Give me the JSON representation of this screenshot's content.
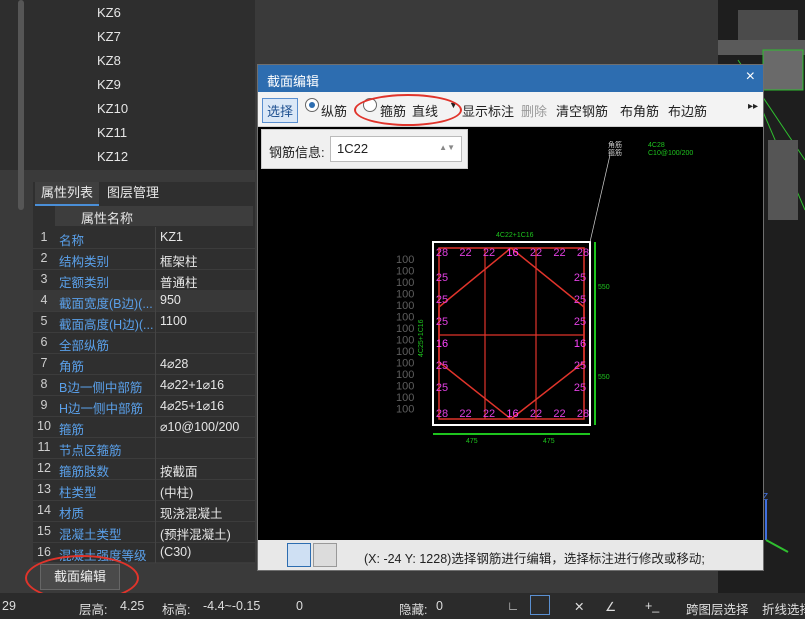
{
  "component_list": [
    "KZ6",
    "KZ7",
    "KZ8",
    "KZ9",
    "KZ10",
    "KZ11",
    "KZ12"
  ],
  "props": {
    "tabs": [
      "属性列表",
      "图层管理"
    ],
    "header": "属性名称",
    "rows": [
      {
        "no": "1",
        "name": "名称",
        "value": "KZ1"
      },
      {
        "no": "2",
        "name": "结构类别",
        "value": "框架柱"
      },
      {
        "no": "3",
        "name": "定额类别",
        "value": "普通柱"
      },
      {
        "no": "4",
        "name": "截面宽度(B边)(...",
        "value": "950"
      },
      {
        "no": "5",
        "name": "截面高度(H边)(...",
        "value": "1100"
      },
      {
        "no": "6",
        "name": "全部纵筋",
        "value": ""
      },
      {
        "no": "7",
        "name": "角筋",
        "value": "4⌀28"
      },
      {
        "no": "8",
        "name": "B边一侧中部筋",
        "value": "4⌀22+1⌀16"
      },
      {
        "no": "9",
        "name": "H边一侧中部筋",
        "value": "4⌀25+1⌀16"
      },
      {
        "no": "10",
        "name": "箍筋",
        "value": "⌀10@100/200"
      },
      {
        "no": "11",
        "name": "节点区箍筋",
        "value": ""
      },
      {
        "no": "12",
        "name": "箍筋肢数",
        "value": "按截面"
      },
      {
        "no": "13",
        "name": "柱类型",
        "value": "(中柱)"
      },
      {
        "no": "14",
        "name": "材质",
        "value": "现浇混凝土"
      },
      {
        "no": "15",
        "name": "混凝土类型",
        "value": "(预拌混凝土)"
      },
      {
        "no": "16",
        "name": "混凝土强度等级",
        "value": "(C30)"
      }
    ]
  },
  "edit_button": "截面编辑",
  "dialog": {
    "title": "截面编辑",
    "close": "×",
    "toolbar": {
      "select": "选择",
      "longitudinal": "纵筋",
      "stirrup": "箍筋",
      "line_mode": "直线",
      "show_annotation": "显示标注",
      "delete": "删除",
      "clear": "清空钢筋",
      "corner": "布角筋",
      "side": "布边筋"
    },
    "rebar_info_label": "钢筋信息:",
    "rebar_info_value": "1C22",
    "drawing": {
      "top_note": "4C22+1C16",
      "corner_note_1": "角筋",
      "corner_note_2": "箍筋",
      "corner_val_1": "4C28",
      "corner_val_2": "C10@100/200",
      "side_note": "4C25+1C16",
      "dim_a": "550",
      "dim_b": "550",
      "dim_c": "475",
      "dim_d": "475",
      "left_dims": [
        "100",
        "100",
        "100",
        "100",
        "100",
        "100",
        "100",
        "100",
        "100",
        "100",
        "100",
        "100",
        "100",
        "100"
      ],
      "top_bars": [
        "28",
        "22",
        "22",
        "16",
        "22",
        "22",
        "28"
      ],
      "bottom_bars": [
        "28",
        "22",
        "22",
        "16",
        "22",
        "22",
        "28"
      ],
      "left_bars": [
        "25",
        "25",
        "25",
        "16",
        "25",
        "25"
      ],
      "right_bars": [
        "25",
        "25",
        "25",
        "16",
        "25",
        "25"
      ]
    },
    "status": "(X: -24 Y: 1228)选择钢筋进行编辑，选择标注进行修改或移动;"
  },
  "bottom_bar": {
    "left_num": "29",
    "floor_label": "层高:",
    "floor_value": "4.25",
    "elev_label": "标高:",
    "elev_value": "-4.4~-0.15",
    "zero": "0",
    "hidden_label": "隐藏:",
    "hidden_value": "0",
    "cross_layer": "跨图层选择",
    "polyline": "折线选择"
  },
  "colors": {
    "accent": "#2d6db0",
    "annot_red": "#e0342b",
    "prop_name": "#5aa0ea"
  }
}
